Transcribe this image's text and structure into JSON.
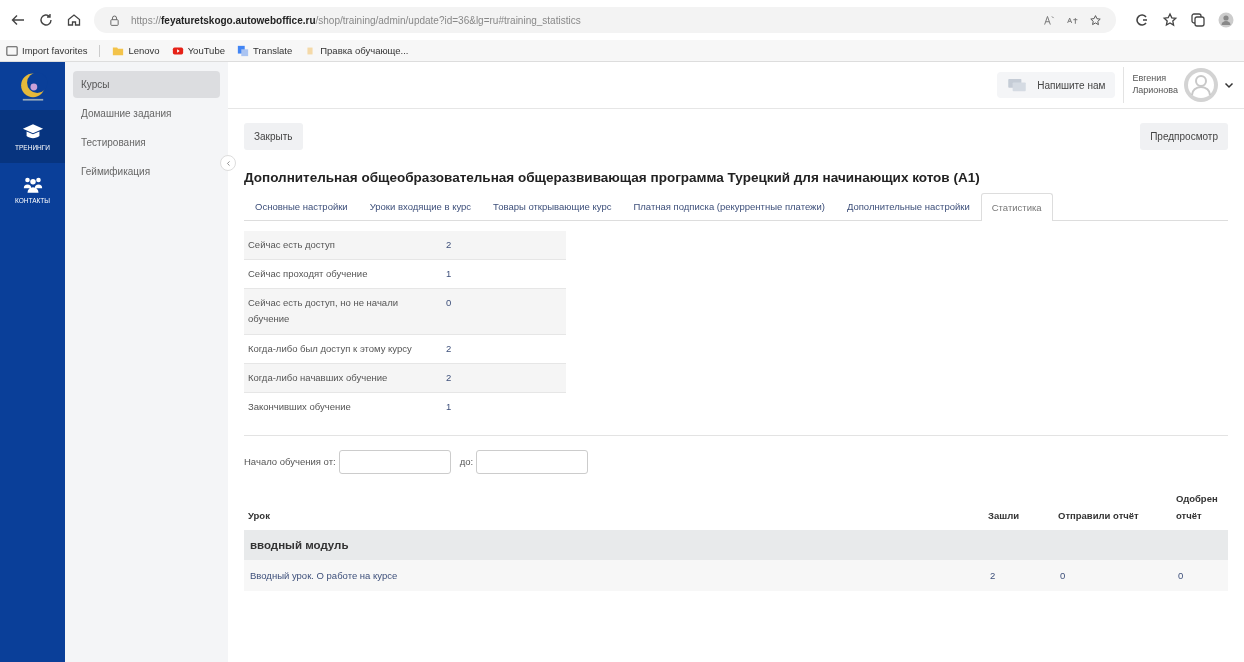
{
  "browser": {
    "url_prefix": "https://",
    "url_domain": "feyaturetskogo.autoweboffice.ru",
    "url_path": "/shop/training/admin/update?id=36&lg=ru#training_statistics",
    "bookmarks": [
      {
        "label": "Import favorites",
        "kind": "import"
      },
      {
        "label": "Lenovo",
        "kind": "folder"
      },
      {
        "label": "YouTube",
        "kind": "youtube"
      },
      {
        "label": "Translate",
        "kind": "translate"
      },
      {
        "label": "Правка обучающе...",
        "kind": "page"
      }
    ]
  },
  "rail": [
    {
      "label": "ТРЕНИНГИ",
      "kind": "cap",
      "selected": true
    },
    {
      "label": "КОНТАКТЫ",
      "kind": "people",
      "selected": false
    }
  ],
  "sidebar": {
    "items": [
      {
        "label": "Курсы",
        "selected": true
      },
      {
        "label": "Домашние задания",
        "selected": false
      },
      {
        "label": "Тестирования",
        "selected": false
      },
      {
        "label": "Геймификация",
        "selected": false
      }
    ]
  },
  "header": {
    "contact_button": "Напишите нам",
    "user_first": "Евгения",
    "user_last": "Ларионова"
  },
  "toolbar": {
    "close_button": "Закрыть",
    "preview_button": "Предпросмотр"
  },
  "title": "Дополнительная общеобразовательная общеразвивающая программа Турецкий для начинающих котов (А1)",
  "tabs": [
    {
      "label": "Основные настройки",
      "selected": false
    },
    {
      "label": "Уроки входящие в курс",
      "selected": false
    },
    {
      "label": "Товары открывающие курс",
      "selected": false
    },
    {
      "label": "Платная подписка (рекуррентные платежи)",
      "selected": false
    },
    {
      "label": "Дополнительные настройки",
      "selected": false
    },
    {
      "label": "Статистика",
      "selected": true
    }
  ],
  "stats": [
    {
      "label": "Сейчас есть доступ",
      "value": "2"
    },
    {
      "label": "Сейчас проходят обучение",
      "value": "1"
    },
    {
      "label": "Сейчас есть доступ, но не начали обучение",
      "value": "0"
    },
    {
      "label": "Когда-либо был доступ к этому курсу",
      "value": "2"
    },
    {
      "label": "Когда-либо начавших обучение",
      "value": "2"
    },
    {
      "label": "Закончивших обучение",
      "value": "1"
    }
  ],
  "filter": {
    "from_label": "Начало обучения от:",
    "to_label": "до:"
  },
  "lessons": {
    "columns": [
      "Урок",
      "Зашли",
      "Отправили отчёт",
      "Одобрен отчёт"
    ],
    "rows": [
      {
        "kind": "module",
        "title": "вводный модуль"
      },
      {
        "kind": "lesson",
        "title": "Вводный урок. О работе на курсе",
        "cells": [
          "2",
          "0",
          "0"
        ]
      }
    ]
  }
}
